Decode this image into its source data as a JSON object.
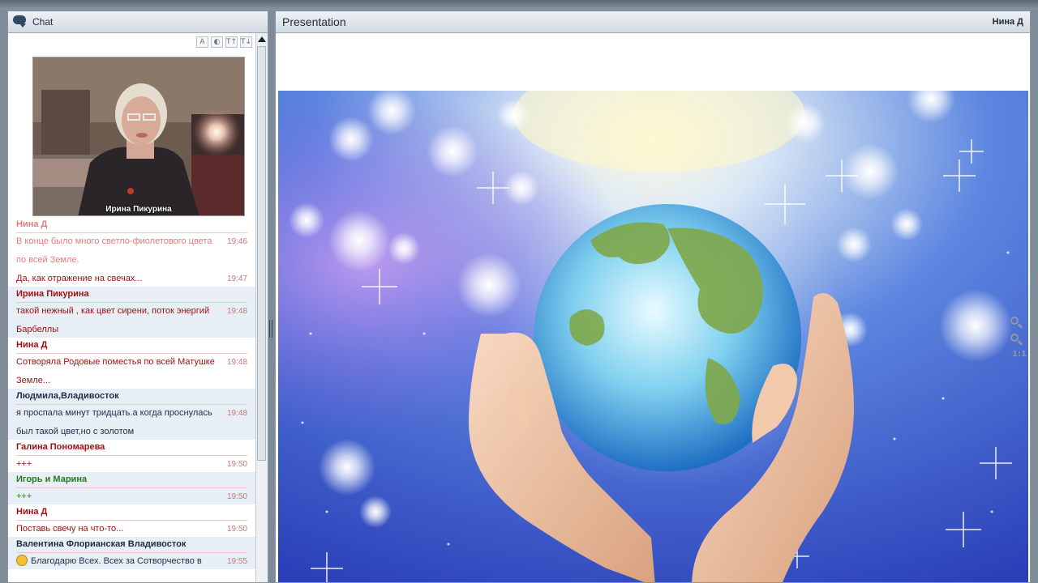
{
  "chat": {
    "title": "Chat",
    "video_caption": "Ирина Пикурина",
    "tools": [
      "A",
      "◐",
      "T↑",
      "T↓"
    ],
    "messages": [
      {
        "sender": "Нина Д",
        "sender_color": "#e27c7c",
        "lines": [
          {
            "text": "В конце было много светло-фиолетового цвета",
            "time": "19:46",
            "color": "#e27c7c"
          },
          {
            "text": "по всей Земле.",
            "time": "",
            "color": "#e27c7c"
          },
          {
            "text": "Да, как отражение на свечах...",
            "time": "19:47",
            "color": "#9b1010"
          }
        ]
      },
      {
        "sender": "Ирина Пикурина",
        "sender_color": "#9b1010",
        "lines": [
          {
            "text": "такой нежный , как цвет сирени, поток энергий",
            "time": "19:48",
            "color": "#9b1010"
          },
          {
            "text": "Барбеллы",
            "time": "",
            "color": "#9b1010"
          }
        ]
      },
      {
        "sender": "Нина Д",
        "sender_color": "#9b1010",
        "lines": [
          {
            "text": "Сотворяла Родовые поместья по всей Матушке",
            "time": "19:48",
            "color": "#9b1010"
          },
          {
            "text": "Земле...",
            "time": "",
            "color": "#9b1010"
          }
        ]
      },
      {
        "sender": "Людмила,Владивосток",
        "sender_color": "#1d2d47",
        "lines": [
          {
            "text": "я проспала минут тридцать.а когда проснулась",
            "time": "19:48",
            "color": "#1d2d47"
          },
          {
            "text": "был такой цвет,но с золотом",
            "time": "",
            "color": "#1d2d47"
          }
        ]
      },
      {
        "sender": "Галина Пономарева",
        "sender_color": "#9b1010",
        "lines": [
          {
            "text": "+++",
            "time": "19:50",
            "color": "#9b1010"
          }
        ]
      },
      {
        "sender": "Игорь и Марина",
        "sender_color": "#207a1d",
        "lines": [
          {
            "text": "+++",
            "time": "19:50",
            "color": "#207a1d"
          }
        ]
      },
      {
        "sender": "Нина Д",
        "sender_color": "#9b1010",
        "lines": [
          {
            "text": "Поставь свечу на что-то...",
            "time": "19:50",
            "color": "#9b1010"
          }
        ]
      },
      {
        "sender": "Валентина Флорианская Владивосток",
        "sender_color": "#1d2d47",
        "lines": [
          {
            "text": "Благодарю Всех. Всех за Сотворчество в",
            "time": "19:55",
            "color": "#1d2d47",
            "emoji": true
          }
        ]
      }
    ]
  },
  "presentation": {
    "title": "Presentation",
    "presenter": "Нина Д",
    "zoom_fit_label": "1:1"
  },
  "icons": [
    "chat-bubble-icon",
    "zoom-in-icon",
    "zoom-out-icon"
  ],
  "colors": {
    "panel_border": "#8b98a4",
    "header_bg": "#d3dbe2",
    "alt_row": "#e8eef5"
  }
}
